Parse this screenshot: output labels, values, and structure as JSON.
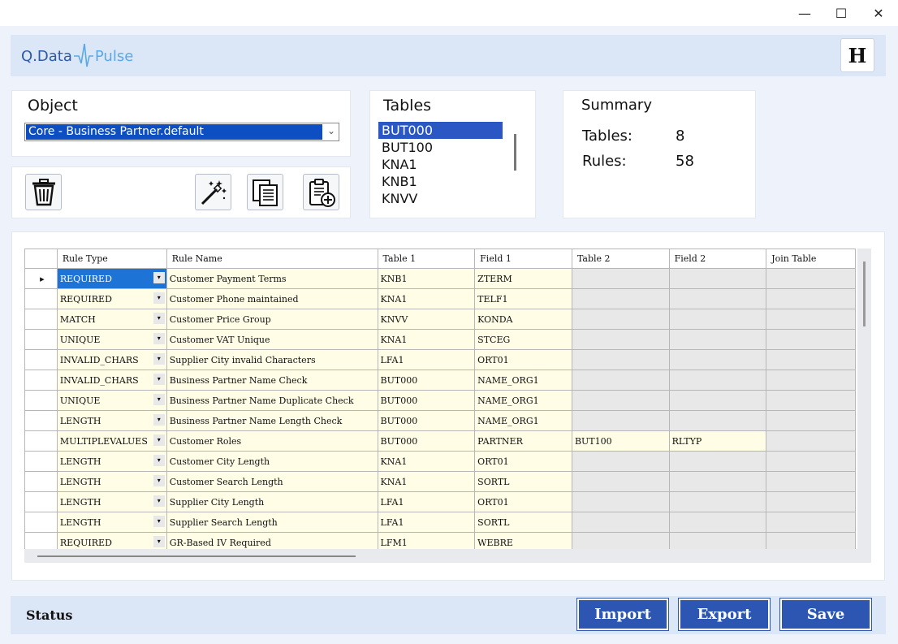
{
  "window": {
    "minimize": "—",
    "maximize": "☐",
    "close": "✕"
  },
  "header": {
    "logo_left": "Q.Data",
    "logo_right": "Pulse",
    "help_label": "H"
  },
  "object_panel": {
    "title": "Object",
    "selected": "Core - Business Partner.default"
  },
  "tables_panel": {
    "title": "Tables",
    "items": [
      "BUT000",
      "BUT100",
      "KNA1",
      "KNB1",
      "KNVV"
    ],
    "selected": "BUT000"
  },
  "summary_panel": {
    "title": "Summary",
    "tables_label": "Tables:",
    "tables_value": "8",
    "rules_label": "Rules:",
    "rules_value": "58"
  },
  "grid": {
    "columns": [
      "Rule Type",
      "Rule Name",
      "Table 1",
      "Field 1",
      "Table 2",
      "Field 2",
      "Join Table"
    ],
    "rows": [
      [
        "REQUIRED",
        "Customer Payment Terms",
        "KNB1",
        "ZTERM",
        "",
        "",
        ""
      ],
      [
        "REQUIRED",
        "Customer Phone maintained",
        "KNA1",
        "TELF1",
        "",
        "",
        ""
      ],
      [
        "MATCH",
        "Customer Price Group",
        "KNVV",
        "KONDA",
        "",
        "",
        ""
      ],
      [
        "UNIQUE",
        "Customer VAT Unique",
        "KNA1",
        "STCEG",
        "",
        "",
        ""
      ],
      [
        "INVALID_CHARS",
        "Supplier City invalid Characters",
        "LFA1",
        "ORT01",
        "",
        "",
        ""
      ],
      [
        "INVALID_CHARS",
        "Business Partner Name Check",
        "BUT000",
        "NAME_ORG1",
        "",
        "",
        ""
      ],
      [
        "UNIQUE",
        "Business Partner Name Duplicate Check",
        "BUT000",
        "NAME_ORG1",
        "",
        "",
        ""
      ],
      [
        "LENGTH",
        "Business Partner Name Length Check",
        "BUT000",
        "NAME_ORG1",
        "",
        "",
        ""
      ],
      [
        "MULTIPLEVALUES",
        "Customer Roles",
        "BUT000",
        "PARTNER",
        "BUT100",
        "RLTYP",
        ""
      ],
      [
        "LENGTH",
        "Customer City Length",
        "KNA1",
        "ORT01",
        "",
        "",
        ""
      ],
      [
        "LENGTH",
        "Customer Search Length",
        "KNA1",
        "SORTL",
        "",
        "",
        ""
      ],
      [
        "LENGTH",
        "Supplier City Length",
        "LFA1",
        "ORT01",
        "",
        "",
        ""
      ],
      [
        "LENGTH",
        "Supplier Search Length",
        "LFA1",
        "SORTL",
        "",
        "",
        ""
      ],
      [
        "REQUIRED",
        "GR-Based IV Required",
        "LFM1",
        "WEBRE",
        "",
        "",
        ""
      ]
    ]
  },
  "footer": {
    "status_label": "Status",
    "import_label": "Import",
    "export_label": "Export",
    "save_label": "Save"
  }
}
